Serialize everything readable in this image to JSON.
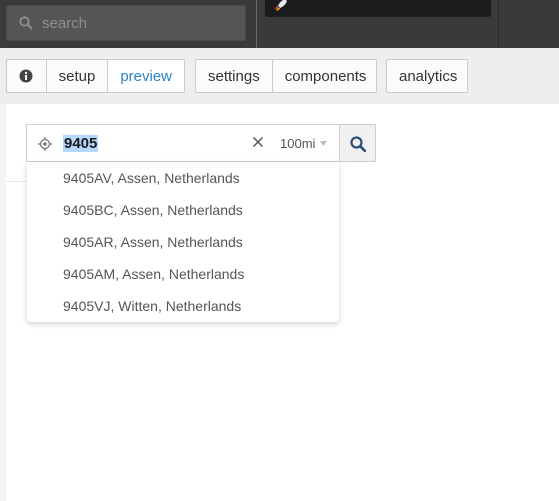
{
  "header": {
    "search_placeholder": "search"
  },
  "tabs": {
    "group1": [
      "setup",
      "preview"
    ],
    "group2": [
      "settings",
      "components"
    ],
    "group3": [
      "analytics"
    ],
    "active": "preview"
  },
  "location_search": {
    "query": "9405",
    "radius": "100mi",
    "suggestions": [
      "9405AV, Assen, Netherlands",
      "9405BC, Assen, Netherlands",
      "9405AR, Assen, Netherlands",
      "9405AM, Assen, Netherlands",
      "9405VJ, Witten, Netherlands"
    ]
  },
  "colors": {
    "accent": "#2a86c8",
    "topbar": "#3a3a3c"
  },
  "icons": [
    "search-icon",
    "rocket-icon",
    "info-icon",
    "location-target-icon",
    "clear-icon",
    "chevron-down-icon",
    "magnifier-icon"
  ]
}
